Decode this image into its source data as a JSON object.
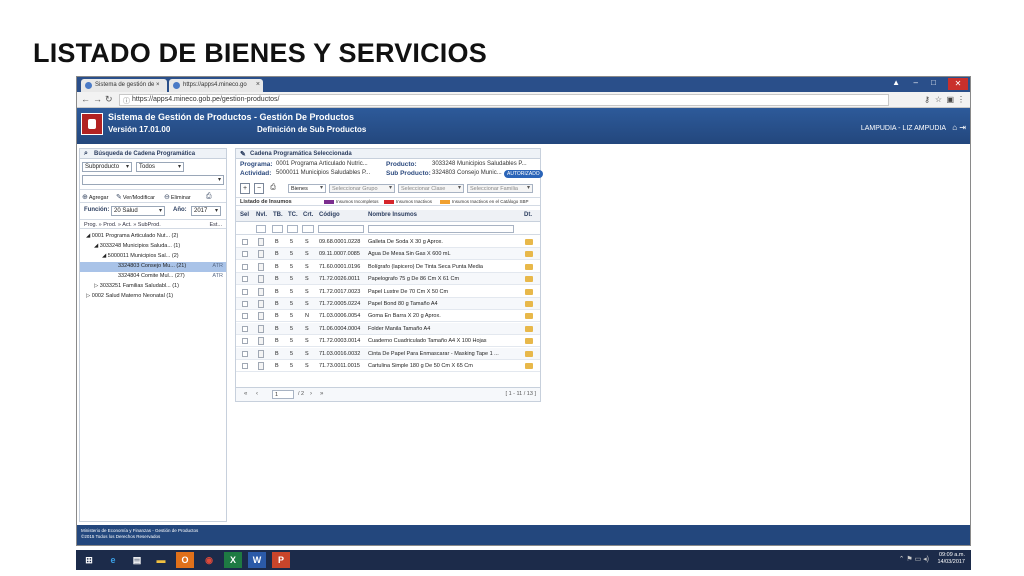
{
  "slide": {
    "title": "LISTADO DE BIENES Y SERVICIOS"
  },
  "browser": {
    "tab1": "Sistema de gestión de ×",
    "tab2": "https://apps4.mineco.go",
    "url": "https://apps4.mineco.gob.pe/gestion-productos/"
  },
  "app": {
    "title": "Sistema de Gestión de Productos - Gestión De Productos",
    "version": "Versión 17.01.00",
    "subtitle": "Definición de Sub Productos",
    "user": "LAMPUDIA - LIZ AMPUDIA"
  },
  "search_panel": {
    "title": "Búsqueda de Cadena Programática",
    "select1": "Subproducto",
    "select2": "Todos",
    "select3": "",
    "btn_add": "Agregar",
    "btn_view": "Ver/Modificar",
    "btn_delete": "Eliminar",
    "funcion_label": "Función:",
    "funcion_value": "20 Salud",
    "anio_label": "Año:",
    "anio_value": "2017",
    "tree_col1": "Prog. » Prod. » Act. » SubProd.",
    "tree_col2": "Est...",
    "tree": [
      {
        "label": "◢ 0001 Programa Articulado Nut... (2)",
        "status": ""
      },
      {
        "label": "◢ 3033248 Municipios Saluda... (1)",
        "status": ""
      },
      {
        "label": "◢ 5000011 Municipios Sal... (2)",
        "status": ""
      },
      {
        "label": "3324803 Consejo Mu... (21)",
        "status": "ATR"
      },
      {
        "label": "3324804 Comite Mul... (27)",
        "status": "ATR"
      },
      {
        "label": "▷ 3033251 Familias Saludabl... (1)",
        "status": ""
      },
      {
        "label": "▷ 0002 Salud Materno Neonatal (1)",
        "status": ""
      }
    ]
  },
  "main_panel": {
    "title": "Cadena Programática Seleccionada",
    "programa_label": "Programa:",
    "programa_value": "0001 Programa Articulado Nutric...",
    "actividad_label": "Actividad:",
    "actividad_value": "5000011 Municipios Saludables P...",
    "producto_label": "Producto:",
    "producto_value": "3033248 Municipios Saludables P...",
    "subproducto_label": "Sub Producto:",
    "subproducto_value": "3324803 Consejo Munic...",
    "badge": "AUTORIZADO",
    "dd_bienes": "Bienes",
    "dd_grupo": "Seleccionar Grupo",
    "dd_clase": "Seleccionar Clase",
    "dd_familia": "Seleccionar Familia",
    "legend_title": "Listado de Insumos",
    "legend": [
      {
        "color": "#7b2d8e",
        "text": "Insumos Incompletos"
      },
      {
        "color": "#d6262b",
        "text": "Insumos Inactivos"
      },
      {
        "color": "#f0a030",
        "text": "Insumos Inactivos en el Catálogo SBP"
      }
    ],
    "columns": {
      "sel": "Sel",
      "nvl": "Nvl.",
      "tb": "TB.",
      "tc": "TC.",
      "crt": "Crt.",
      "codigo": "Código",
      "nombre": "Nombre Insumos",
      "dt": "Dt."
    },
    "rows": [
      {
        "tb": "B",
        "tc": "5",
        "crt": "S",
        "codigo": "09.68.0001.0228",
        "nombre": "Galleta De Soda X 30 g Aprox."
      },
      {
        "tb": "B",
        "tc": "5",
        "crt": "S",
        "codigo": "09.11.0007.0085",
        "nombre": "Agua De Mesa Sin Gas X 600 mL"
      },
      {
        "tb": "B",
        "tc": "5",
        "crt": "S",
        "codigo": "71.60.0001.0196",
        "nombre": "Bolígrafo (lapicero) De Tinta Seca Punta Media"
      },
      {
        "tb": "B",
        "tc": "5",
        "crt": "S",
        "codigo": "71.72.0026.0011",
        "nombre": "Papelografo 75 g De 86 Cm X 61 Cm"
      },
      {
        "tb": "B",
        "tc": "5",
        "crt": "S",
        "codigo": "71.72.0017.0023",
        "nombre": "Papel Lustre De 70 Cm X 50 Cm"
      },
      {
        "tb": "B",
        "tc": "5",
        "crt": "S",
        "codigo": "71.72.0005.0224",
        "nombre": "Papel Bond 80 g Tamaño A4"
      },
      {
        "tb": "B",
        "tc": "5",
        "crt": "N",
        "codigo": "71.03.0006.0054",
        "nombre": "Goma En Barra X 20 g Aprox."
      },
      {
        "tb": "B",
        "tc": "5",
        "crt": "S",
        "codigo": "71.06.0004.0004",
        "nombre": "Folder Manila Tamaño A4"
      },
      {
        "tb": "B",
        "tc": "5",
        "crt": "S",
        "codigo": "71.72.0003.0014",
        "nombre": "Cuaderno Cuadriculado Tamaño A4 X 100 Hojas"
      },
      {
        "tb": "B",
        "tc": "5",
        "crt": "S",
        "codigo": "71.03.0016.0032",
        "nombre": "Cinta De Papel Para Enmascarar - Masking Tape 1 ..."
      },
      {
        "tb": "B",
        "tc": "5",
        "crt": "S",
        "codigo": "71.73.0011.0015",
        "nombre": "Cartulina Simple 180 g De 50 Cm X 65 Cm"
      }
    ],
    "pager_page": "1",
    "pager_total": "/ 2",
    "pager_range": "[ 1 - 11 / 13 ]"
  },
  "footer": {
    "line1": "Ministerio de Economía y Finanzas - Gestión de Productos",
    "line2": "©2015 Todos los Derechos Reservados"
  },
  "taskbar": {
    "time": "09:09 a.m.",
    "date": "14/03/2017"
  }
}
